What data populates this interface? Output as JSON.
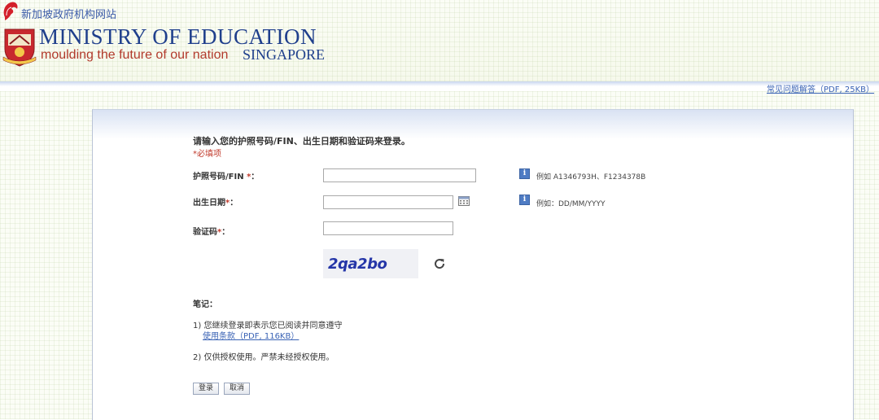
{
  "header": {
    "gov_link": "新加坡政府机构网站",
    "title": "MINISTRY OF EDUCATION",
    "tagline": "moulding the future of our nation",
    "country": "SINGAPORE",
    "faq_link": "常见问题解答（PDF, 25KB）"
  },
  "form": {
    "instruction": "请输入您的护照号码/FIN、出生日期和验证码来登录。",
    "required_note": "*必填项",
    "fields": [
      {
        "label": "护照号码/FIN",
        "star": "*",
        "suffix": "：",
        "value": "",
        "hint": "例如 A1346793H、F1234378B"
      },
      {
        "label": "出生日期",
        "star": "*",
        "suffix": "：",
        "value": "",
        "hint": "例如：DD/MM/YYYY"
      },
      {
        "label": "验证码",
        "star": "*",
        "suffix": "：",
        "value": ""
      }
    ],
    "captcha_text": "2qa2bo"
  },
  "notes": {
    "title": "笔记：",
    "note1": "1) 您继续登录即表示您已阅读并同意遵守",
    "terms_link": "使用条款（PDF, 116KB）",
    "note2": "2) 仅供授权使用。严禁未经授权使用。"
  },
  "buttons": {
    "login": "登录",
    "cancel": "取消"
  },
  "colors": {
    "brand_blue": "#1f3f8c",
    "brand_red": "#b23a2c",
    "link": "#3a63b5",
    "required": "#c0392b"
  }
}
